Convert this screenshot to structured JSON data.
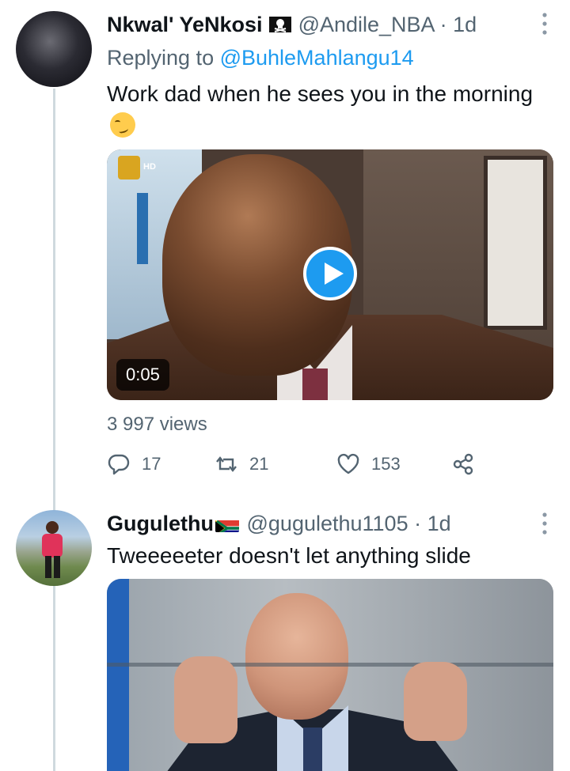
{
  "tweets": [
    {
      "display_name": "Nkwal' YeNkosi",
      "name_emoji": "pirate-flag",
      "handle": "@Andile_NBA",
      "time": "1d",
      "replying_to_prefix": "Replying to ",
      "replying_to_handle": "@BuhleMahlangu14",
      "text": "Work dad when he sees you in the morning",
      "text_emoji": "smirking-face",
      "media": {
        "type": "video",
        "duration": "0:05",
        "channel_badge": "HD"
      },
      "views": "3 997 views",
      "actions": {
        "reply_count": "17",
        "retweet_count": "21",
        "like_count": "153"
      }
    },
    {
      "display_name": "Gugulethu",
      "name_emoji": "south-africa-flag",
      "handle": "@gugulethu1105",
      "time": "1d",
      "text": "Tweeeeeter doesn't let anything slide",
      "media": {
        "type": "image"
      }
    }
  ],
  "colors": {
    "accent": "#1d9bf0",
    "secondary_text": "#536471",
    "thread_line": "#cfd9de"
  }
}
